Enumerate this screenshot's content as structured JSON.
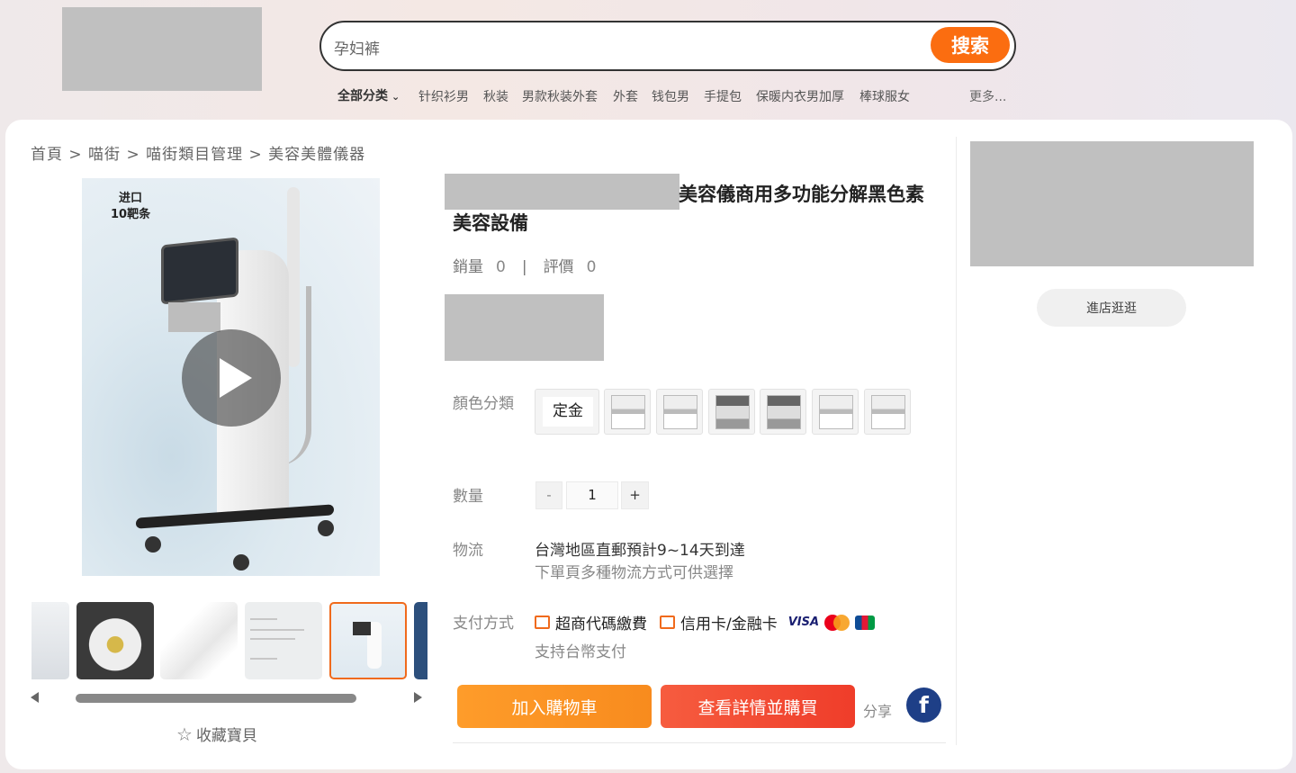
{
  "header": {
    "search": {
      "value": "孕妇裤",
      "button_label": "搜索"
    },
    "hot": {
      "all_label": "全部分类",
      "items": [
        "针织衫男",
        "秋装",
        "男款秋装外套",
        "外套",
        "钱包男",
        "手提包",
        "保暖内衣男加厚",
        "棒球服女"
      ],
      "more_label": "更多..."
    }
  },
  "breadcrumb": "首頁 > 喵街 > 喵街類目管理 > 美容美體儀器",
  "gallery": {
    "badge_line1": "进口",
    "badge_line2": "10靶条",
    "favorite_label": "收藏寶貝"
  },
  "product": {
    "title_line1": "美容儀商用多功能分解黑色素",
    "title_line2": "美容設備",
    "sales_label": "銷量",
    "sales_value": "0",
    "reviews_label": "評價",
    "reviews_value": "0",
    "color_label": "顏色分類",
    "color_text_option": "定金",
    "quantity_label": "數量",
    "quantity": {
      "minus": "-",
      "value": "1",
      "plus": "+"
    },
    "logistics_label": "物流",
    "logistics_main": "台灣地區直郵預計9~14天到達",
    "logistics_sub": "下單頁多種物流方式可供選擇",
    "payment_label": "支付方式",
    "payment_option_1": "超商代碼繳費",
    "payment_option_2": "信用卡/金融卡",
    "payment_visa": "VISA",
    "payment_sub": "支持台幣支付",
    "add_to_cart": "加入購物車",
    "view_and_buy": "查看詳情並購買",
    "share_label": "分享",
    "fb_letter": "f"
  },
  "store": {
    "visit_label": "進店逛逛"
  },
  "colors": {
    "accent": "#fb6d10",
    "buy": "#ef3d2a",
    "cart": "#fe9c2a",
    "facebook": "#1e3f87"
  }
}
